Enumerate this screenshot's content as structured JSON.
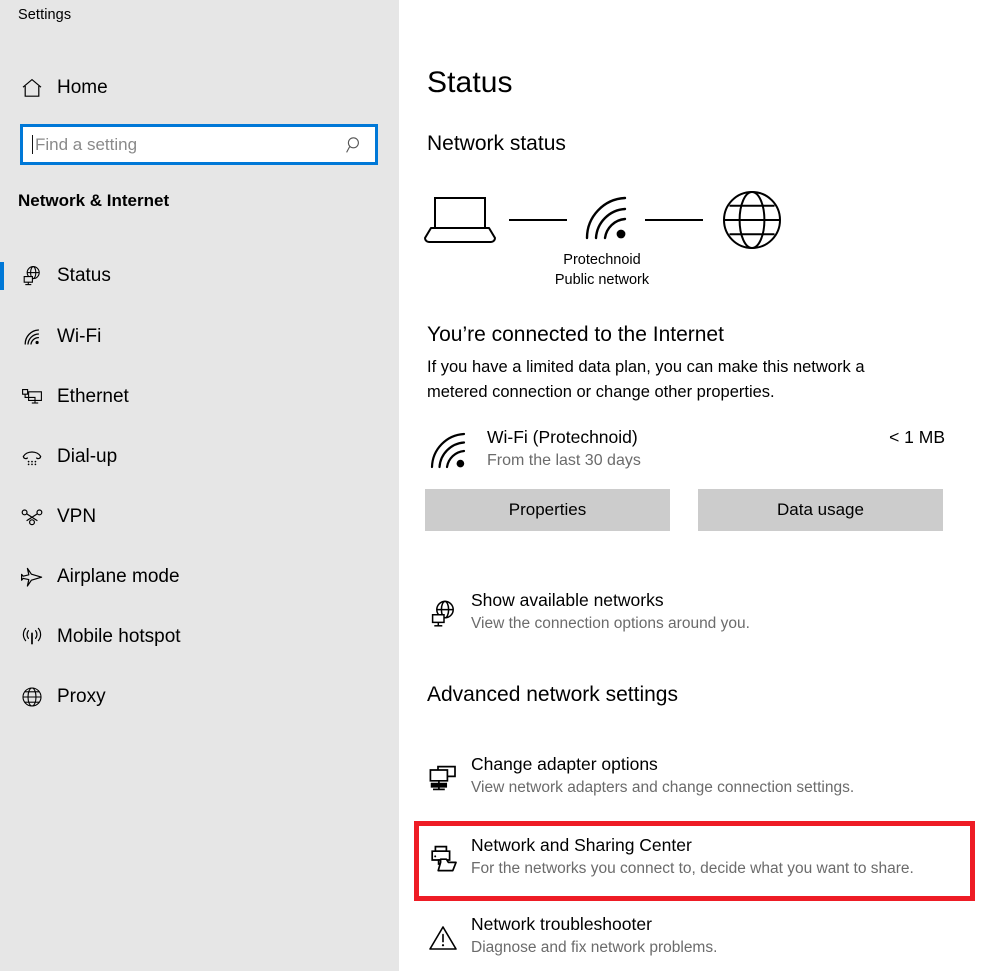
{
  "window": {
    "title": "Settings"
  },
  "colors": {
    "accent": "#0078d7",
    "sidebar_bg": "#e6e6e6",
    "content_bg": "#ffffff",
    "button_bg": "#cccccc",
    "subtext": "#6b6b6b",
    "highlight_outline": "#ee1c25"
  },
  "sidebar": {
    "home": {
      "label": "Home",
      "icon": "home-icon"
    },
    "search": {
      "value": "",
      "placeholder": "Find a setting",
      "icon": "search-icon"
    },
    "category_title": "Network & Internet",
    "items": [
      {
        "label": "Status",
        "icon": "globe-monitor-icon",
        "selected": true
      },
      {
        "label": "Wi-Fi",
        "icon": "wifi-icon",
        "selected": false
      },
      {
        "label": "Ethernet",
        "icon": "ethernet-icon",
        "selected": false
      },
      {
        "label": "Dial-up",
        "icon": "dialup-phone-icon",
        "selected": false
      },
      {
        "label": "VPN",
        "icon": "vpn-icon",
        "selected": false
      },
      {
        "label": "Airplane mode",
        "icon": "airplane-icon",
        "selected": false
      },
      {
        "label": "Mobile hotspot",
        "icon": "hotspot-icon",
        "selected": false
      },
      {
        "label": "Proxy",
        "icon": "globe-icon",
        "selected": false
      }
    ]
  },
  "main": {
    "page_title": "Status",
    "network_status_heading": "Network status",
    "diagram": {
      "device_icon": "laptop-icon",
      "link_icon": "wifi-icon",
      "internet_icon": "globe-icon",
      "network_name": "Protechnoid",
      "network_type": "Public network"
    },
    "connected_heading": "You’re connected to the Internet",
    "body_line_1": "If you have a limited data plan, you can make this network a",
    "body_line_2": "metered connection or change other properties.",
    "usage": {
      "icon": "wifi-icon",
      "title": "Wi-Fi (Protechnoid)",
      "subtitle": "From the last 30 days",
      "amount": "< 1 MB"
    },
    "buttons": {
      "properties": "Properties",
      "data_usage": "Data usage"
    },
    "show_networks": {
      "icon": "globe-monitor-icon",
      "title": "Show available networks",
      "subtitle": "View the connection options around you."
    },
    "advanced_heading": "Advanced network settings",
    "advanced_items": [
      {
        "icon": "two-monitors-network-icon",
        "title": "Change adapter options",
        "subtitle": "View network adapters and change connection settings.",
        "highlighted": false
      },
      {
        "icon": "printer-folder-share-icon",
        "title": "Network and Sharing Center",
        "subtitle": "For the networks you connect to, decide what you want to share.",
        "highlighted": true
      },
      {
        "icon": "warning-triangle-icon",
        "title": "Network troubleshooter",
        "subtitle": "Diagnose and fix network problems.",
        "highlighted": false
      }
    ]
  }
}
